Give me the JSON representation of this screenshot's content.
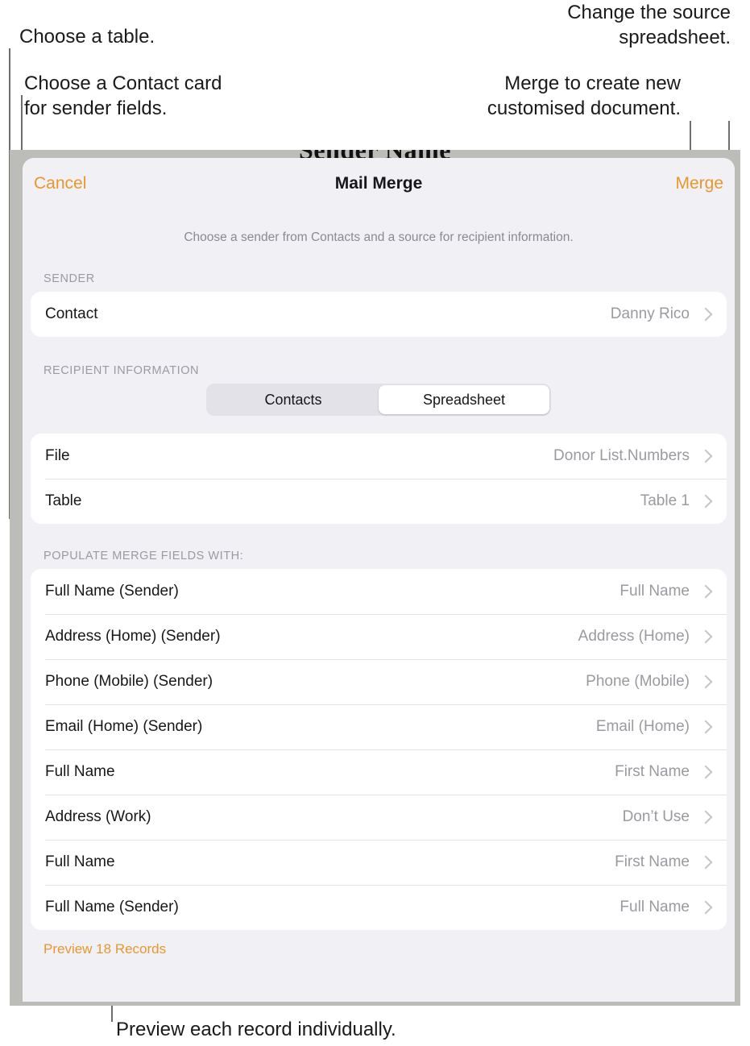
{
  "annotations": {
    "choose_table": "Choose a table.",
    "choose_contact": "Choose a Contact card\nfor sender fields.",
    "change_source": "Change the source\nspreadsheet.",
    "merge_create": "Merge to create new\ncustomised document.",
    "preview_each": "Preview each record individually."
  },
  "document": {
    "peek_title": "Sender Name"
  },
  "sheet": {
    "cancel_label": "Cancel",
    "title": "Mail Merge",
    "merge_label": "Merge",
    "subtitle": "Choose a sender from Contacts and a source for recipient information.",
    "sender": {
      "group_label": "SENDER",
      "rows": [
        {
          "label": "Contact",
          "value": "Danny Rico"
        }
      ]
    },
    "recipient": {
      "group_label": "RECIPIENT INFORMATION",
      "segments": [
        {
          "label": "Contacts",
          "selected": false
        },
        {
          "label": "Spreadsheet",
          "selected": true
        }
      ],
      "rows": [
        {
          "label": "File",
          "value": "Donor List.Numbers"
        },
        {
          "label": "Table",
          "value": "Table 1"
        }
      ]
    },
    "merge_fields": {
      "group_label": "POPULATE MERGE FIELDS WITH:",
      "rows": [
        {
          "label": "Full Name (Sender)",
          "value": "Full Name"
        },
        {
          "label": "Address (Home) (Sender)",
          "value": "Address (Home)"
        },
        {
          "label": "Phone (Mobile) (Sender)",
          "value": "Phone (Mobile)"
        },
        {
          "label": "Email (Home) (Sender)",
          "value": "Email (Home)"
        },
        {
          "label": "Full Name",
          "value": "First Name"
        },
        {
          "label": "Address (Work)",
          "value": "Don’t Use"
        },
        {
          "label": "Full Name",
          "value": "First Name"
        },
        {
          "label": "Full Name (Sender)",
          "value": "Full Name"
        }
      ]
    },
    "footer": {
      "preview_label": "Preview 18 Records"
    }
  },
  "colors": {
    "accent": "#e8972e",
    "sheet_background": "#f1f0f5",
    "card_background": "#ffffff",
    "frame": "#bcbcb8",
    "value_text": "#9a9aa0",
    "label_text": "#17171a"
  }
}
